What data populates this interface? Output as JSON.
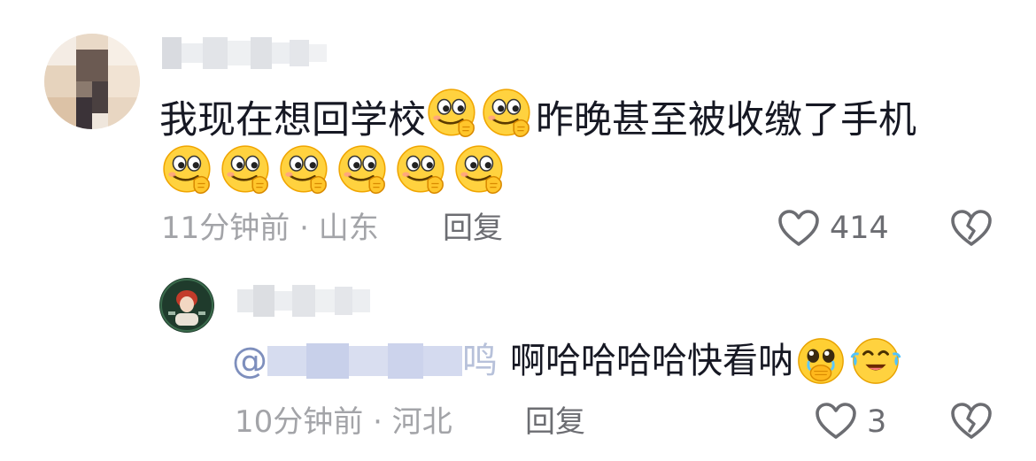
{
  "comments": [
    {
      "username": "",
      "text_part1": "我现在想回学校",
      "text_part2": "昨晚甚至被收缴了手机",
      "emoji_name": "thinking-smirk-emoji",
      "time": "11分钟前",
      "separator": "·",
      "location": "山东",
      "reply_label": "回复",
      "like_count": "414",
      "icons": [
        "heart-icon",
        "broken-heart-icon"
      ]
    }
  ],
  "replies": [
    {
      "username": "",
      "mention_prefix": "@",
      "mention_name": "",
      "mention_tail": "鸣",
      "text": "啊哈哈哈哈快看呐",
      "emojis": [
        "pleading-face-emoji",
        "tears-of-joy-emoji"
      ],
      "time": "10分钟前",
      "separator": "·",
      "location": "河北",
      "reply_label": "回复",
      "like_count": "3",
      "icons": [
        "heart-icon",
        "broken-heart-icon"
      ]
    }
  ],
  "colors": {
    "primary_text": "#161823",
    "meta_text": "#a3a4a8",
    "mention_text": "#7e8fbd",
    "icon": "#6c6d72"
  }
}
